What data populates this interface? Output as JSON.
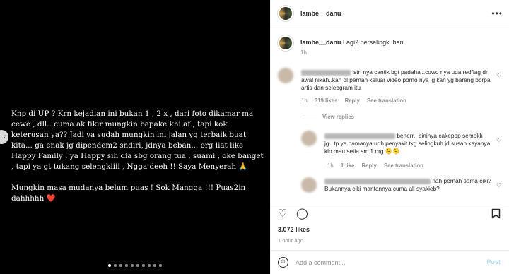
{
  "media": {
    "paragraph1": "Knp di UP ? Krn kejadian ini bukan 1 , 2 x , dari foto dikamar ma cewe , dll.. cuma ak fikir mungkin bapake khilaf , tapi kok keterusan ya?? Jadi ya sudah mungkin ini jalan yg terbaik buat kita... ga enak jg dipendem2 sndiri, jdnya beban... org liat like Happy Family , ya Happy sih dia sbg orang tua , suami , oke banget , tapi ya gt tukang selengkiiii , Ngga deeh !! Saya Menyerah 🙏",
    "paragraph2": "Mungkin masa mudanya belum puas ! Sok Mangga !!! Puas2in dahhhhh",
    "heart": "❤️",
    "prev_arrow": "‹",
    "carousel_count": 10,
    "carousel_active": 0
  },
  "header": {
    "username": "lambe__danu",
    "more": "•••"
  },
  "caption": {
    "username": "lambe__danu",
    "text": "Lagi2 perselingkuhan",
    "time": "1h"
  },
  "comments": [
    {
      "text": "istri nya cantik bgt padahal..cowo nya uda redflag dr awal nikah..kan dl pernah keluar video porno nya jg kan yg bareng bbrpa artis dan selebgram itu",
      "time": "1h",
      "likes": "319 likes",
      "reply": "Reply",
      "translate": "See translation"
    },
    {
      "text": "benerr.. bininya cakeppp semokk jg.. tp ya namanya udh penyakit tkg selingkuh jd susah kayanya klo mau setia sm 1 org 🫠🫠",
      "time": "1h",
      "likes": "1 like",
      "reply": "Reply",
      "translate": "See translation"
    },
    {
      "text": "hah pernah sama ciki? Bukannya ciki mantannya cuma ali syakieb?",
      "time": "",
      "likes": "",
      "reply": "",
      "translate": ""
    }
  ],
  "view_replies": "View replies",
  "actions": {
    "like": "♡",
    "comment": "◯",
    "likes_count": "3.072 likes",
    "time": "1 hour ago"
  },
  "add_comment": {
    "emoji": "☺",
    "placeholder": "Add a comment...",
    "post": "Post"
  }
}
